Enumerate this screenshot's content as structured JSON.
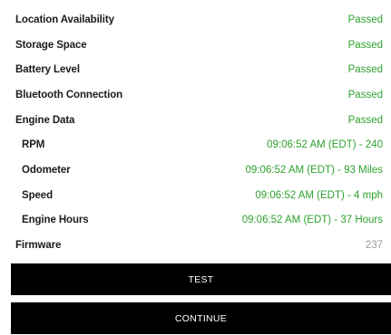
{
  "checks": [
    {
      "label": "Location Availability",
      "status": "Passed"
    },
    {
      "label": "Storage Space",
      "status": "Passed"
    },
    {
      "label": "Battery Level",
      "status": "Passed"
    },
    {
      "label": "Bluetooth Connection",
      "status": "Passed"
    },
    {
      "label": "Engine Data",
      "status": "Passed"
    }
  ],
  "engine": [
    {
      "label": "RPM",
      "value": "09:06:52 AM (EDT) - 240"
    },
    {
      "label": "Odometer",
      "value": "09:06:52 AM (EDT) - 93 Miles"
    },
    {
      "label": "Speed",
      "value": "09:06:52 AM (EDT) - 4 mph"
    },
    {
      "label": "Engine Hours",
      "value": "09:06:52 AM (EDT) - 37 Hours"
    }
  ],
  "firmware": {
    "label": "Firmware",
    "value": "237"
  },
  "buttons": {
    "test": "TEST",
    "continue": "CONTINUE"
  },
  "colors": {
    "passed": "#2ea12e",
    "button_bg": "#000000",
    "muted": "#9a9a9a"
  }
}
